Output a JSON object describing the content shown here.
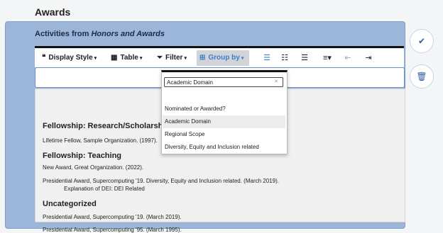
{
  "section": {
    "title": "Awards"
  },
  "panel": {
    "title_prefix": "Activities from ",
    "title_source": "Honors and Awards"
  },
  "toolbar": {
    "display_style": "Display Style",
    "table": "Table",
    "filter": "Filter",
    "group_by": "Group by",
    "caret": "▾"
  },
  "dropdown": {
    "search_value": "Academic Domain",
    "options": [
      "Nominated or Awarded?",
      "Academic Domain",
      "Regional Scope",
      "Diversity, Equity and Inclusion related"
    ],
    "highlighted": "Academic Domain"
  },
  "groups": [
    {
      "title": "Fellowship: Research/Scholarship",
      "items": [
        "Lifetime Fellow, Sample Organization. (1997)."
      ]
    },
    {
      "title": "Fellowship: Teaching",
      "items": [
        "New Award, Great Organization. (2022).",
        "Presidential Award, Supercomputing '19. Diversity, Equity and Inclusion related. (March 2019)."
      ],
      "sub": "Explanation of DEI: DEI Related"
    },
    {
      "title": "Uncategorized",
      "items": [
        "Presidential Award, Supercomputing '19. (March 2019).",
        "Presidential Award, Supercomputing '95. (March 1995)."
      ]
    }
  ],
  "icons": {
    "quote": "quote-icon",
    "table": "table-icon",
    "filter": "filter-icon",
    "group": "group-icon",
    "confirm": "check-icon",
    "delete": "trash-icon"
  },
  "colors": {
    "panel": "#9bb6d9",
    "accent": "#3d7cc9",
    "circle_icon": "#2f5f9f"
  }
}
